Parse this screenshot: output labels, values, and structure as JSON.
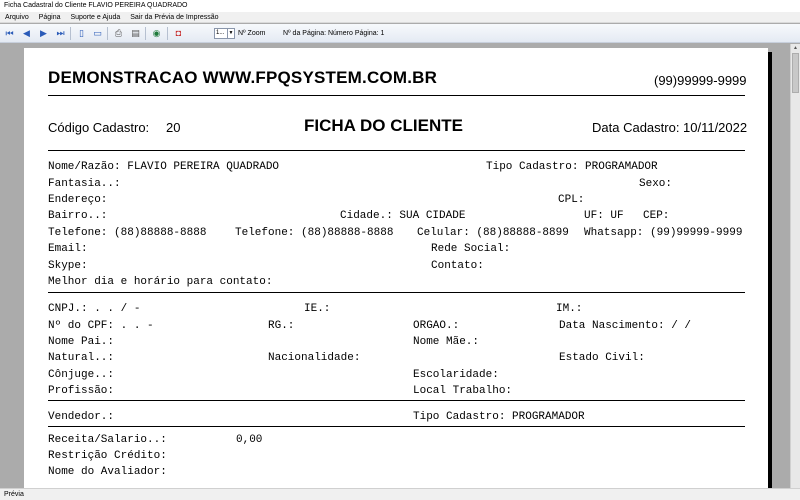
{
  "window": {
    "title": "Ficha Cadastral do Cliente FLAVIO PEREIRA QUADRADO"
  },
  "menu": [
    "Arquivo",
    "Página",
    "Suporte e Ajuda",
    "Sair da Prévia de Impressão"
  ],
  "toolbar": {
    "zoom_value": "1...",
    "zoom_label": "Nº Zoom",
    "page_label": "Nº da Página: Número Página: 1"
  },
  "status": "Prévia",
  "report": {
    "company": "DEMONSTRACAO WWW.FPQSYSTEM.COM.BR",
    "phone": "(99)99999-9999",
    "code_label": "Código Cadastro:",
    "code_value": "20",
    "title": "FICHA DO CLIENTE",
    "date_label": "Data Cadastro:",
    "date_value": "10/11/2022",
    "section1": {
      "nome": "Nome/Razão: FLAVIO PEREIRA QUADRADO",
      "tipo": "Tipo Cadastro: PROGRAMADOR",
      "fantasia": "Fantasia..:",
      "sexo": "Sexo:",
      "endereco": "Endereço:",
      "cpl": "CPL:",
      "bairro": "Bairro..:",
      "cidade": "Cidade.: SUA CIDADE",
      "uf": "UF: UF",
      "cep": "CEP:",
      "telefone1": "Telefone: (88)88888-8888",
      "telefone2": "Telefone: (88)88888-8888",
      "celular": "Celular: (88)88888-8899",
      "whatsapp": "Whatsapp: (99)99999-9999",
      "email": "Email:",
      "rede": "Rede Social:",
      "skype": "Skype:",
      "contato": "Contato:",
      "melhor": "Melhor dia e horário para contato:"
    },
    "section2": {
      "cnpj": "CNPJ.:   .   .   /   -",
      "ie": "IE.:",
      "im": "IM.:",
      "cpf": "Nº do CPF:   .   .   -",
      "rg": "RG.:",
      "orgao": "ORGAO.:",
      "nascimento": "Data Nascimento:  /  /",
      "pai": "Nome Pai.:",
      "mae": "Nome Mãe.:",
      "natural": "Natural..:",
      "nacionalidade": "Nacionalidade:",
      "civil": "Estado Civil:",
      "conjuge": "Cônjuge..:",
      "escolaridade": "Escolaridade:",
      "profissao": "Profissão:",
      "trabalho": "Local Trabalho:"
    },
    "section3": {
      "vendedor": "Vendedor.:",
      "tipo": "Tipo Cadastro: PROGRAMADOR"
    },
    "section4": {
      "receita_label": "Receita/Salario..:",
      "receita_value": "0,00",
      "restricao": "Restrição Crédito:",
      "avaliador": "Nome do Avaliador:"
    }
  }
}
